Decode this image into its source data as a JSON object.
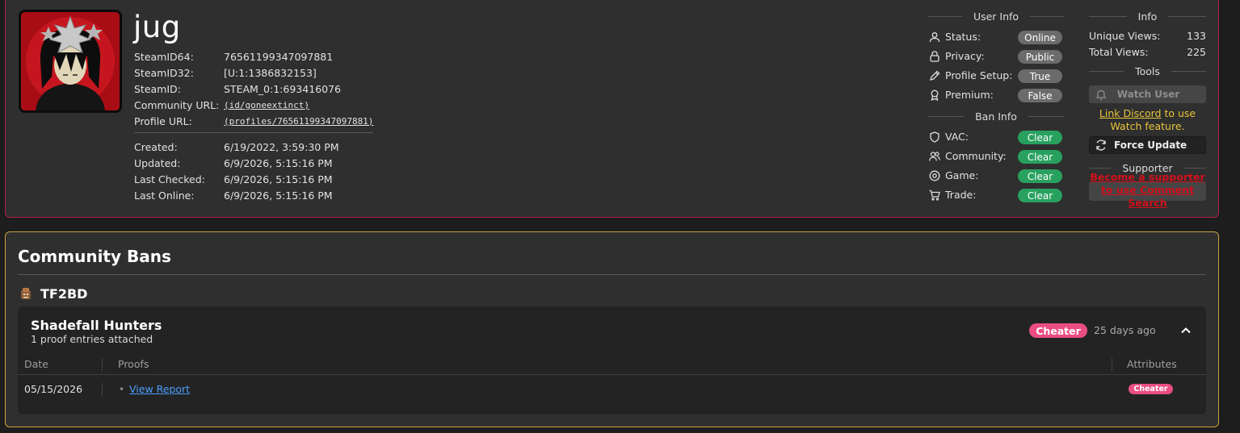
{
  "profile": {
    "username": "jug",
    "ids": [
      {
        "label": "SteamID64:",
        "value": "76561199347097881"
      },
      {
        "label": "SteamID32:",
        "value": "[U:1:1386832153]"
      },
      {
        "label": "SteamID:",
        "value": "STEAM_0:1:693416076"
      },
      {
        "label": "Community URL:",
        "value": "(id/goneextinct)"
      },
      {
        "label": "Profile URL:",
        "value": "(profiles/76561199347097881)"
      }
    ],
    "dates": [
      {
        "label": "Created:",
        "value": "6/19/2022, 3:59:30 PM"
      },
      {
        "label": "Updated:",
        "value": "6/9/2026, 5:15:16 PM"
      },
      {
        "label": "Last Checked:",
        "value": "6/9/2026, 5:15:16 PM"
      },
      {
        "label": "Last Online:",
        "value": "6/9/2026, 5:15:16 PM"
      }
    ]
  },
  "user_info": {
    "heading": "User Info",
    "rows": [
      {
        "icon": "user-icon",
        "label": "Status:",
        "value": "Online"
      },
      {
        "icon": "lock-icon",
        "label": "Privacy:",
        "value": "Public"
      },
      {
        "icon": "pencil-icon",
        "label": "Profile Setup:",
        "value": "True"
      },
      {
        "icon": "award-icon",
        "label": "Premium:",
        "value": "False"
      }
    ]
  },
  "ban_info": {
    "heading": "Ban Info",
    "rows": [
      {
        "icon": "shield-icon",
        "label": "VAC:",
        "value": "Clear"
      },
      {
        "icon": "users-icon",
        "label": "Community:",
        "value": "Clear"
      },
      {
        "icon": "target-icon",
        "label": "Game:",
        "value": "Clear"
      },
      {
        "icon": "cart-icon",
        "label": "Trade:",
        "value": "Clear"
      }
    ]
  },
  "info": {
    "heading": "Info",
    "unique_views_label": "Unique Views:",
    "unique_views": "133",
    "total_views_label": "Total Views:",
    "total_views": "225"
  },
  "tools": {
    "heading": "Tools",
    "watch_label": "Watch User",
    "discord_link": "Link Discord",
    "discord_suffix": " to use Watch feature.",
    "force_label": "Force Update"
  },
  "supporter": {
    "heading": "Supporter",
    "link": "Become a supporter to use Comment Search"
  },
  "bans": {
    "title": "Community Bans",
    "source": "TF2BD",
    "group": {
      "name": "Shadefall Hunters",
      "subtitle": "1 proof entries attached",
      "badge": "Cheater",
      "time_ago": "25 days ago",
      "columns": {
        "date": "Date",
        "proofs": "Proofs",
        "attributes": "Attributes"
      },
      "entries": [
        {
          "date": "05/15/2026",
          "proof": "View Report",
          "attribute": "Cheater"
        }
      ]
    }
  },
  "colors": {
    "profile_border": "#b51f43",
    "bans_border": "#c8a33b",
    "clear_green": "#28a15f",
    "cheater_pink": "#ea4d83",
    "link_blue": "#4b9fff",
    "discord_yellow": "#e8c53a",
    "supporter_red": "#d1111b"
  }
}
